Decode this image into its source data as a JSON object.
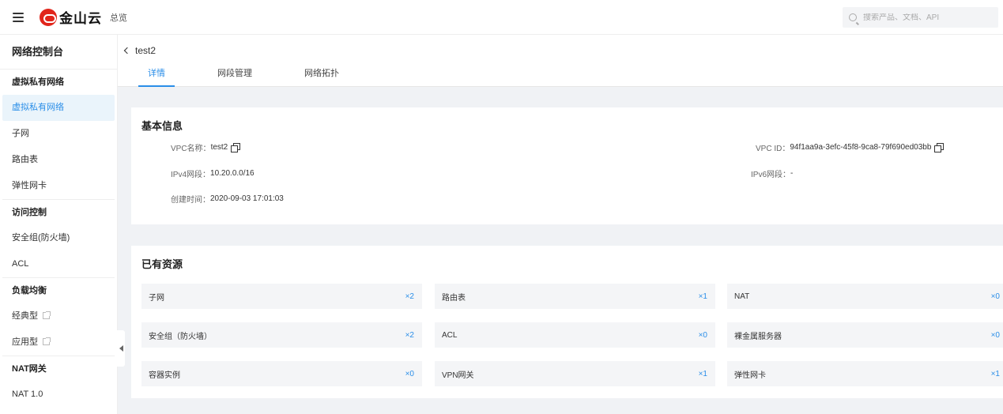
{
  "topbar": {
    "logo_text": "金山云",
    "overview": "总览",
    "search_placeholder": "搜索产品、文档、API"
  },
  "sidebar": {
    "title": "网络控制台",
    "groups": [
      {
        "label": "虚拟私有网络",
        "items": [
          "虚拟私有网络",
          "子网",
          "路由表",
          "弹性网卡"
        ]
      },
      {
        "label": "访问控制",
        "items": [
          "安全组(防火墙)",
          "ACL"
        ]
      },
      {
        "label": "负载均衡",
        "items": [
          "经典型",
          "应用型"
        ]
      },
      {
        "label": "NAT网关",
        "items": [
          "NAT 1.0"
        ]
      }
    ]
  },
  "header": {
    "back_label": "test2",
    "tabs": [
      "详情",
      "网段管理",
      "网络拓扑"
    ]
  },
  "basic_info": {
    "title": "基本信息",
    "vpc_name_label": "VPC名称：",
    "vpc_name": "test2",
    "ipv4_label": "IPv4网段：",
    "ipv4": "10.20.0.0/16",
    "created_label": "创建时间：",
    "created": "2020-09-03 17:01:03",
    "vpc_id_label": "VPC ID：",
    "vpc_id": "94f1aa9a-3efc-45f8-9ca8-79f690ed03bb",
    "ipv6_label": "IPv6网段：",
    "ipv6": "-"
  },
  "resources": {
    "title": "已有资源",
    "items": [
      {
        "name": "子网",
        "count": "×2"
      },
      {
        "name": "路由表",
        "count": "×1"
      },
      {
        "name": "NAT",
        "count": "×0"
      },
      {
        "name": "安全组（防火墙）",
        "count": "×2"
      },
      {
        "name": "ACL",
        "count": "×0"
      },
      {
        "name": "裸金属服务器",
        "count": "×0"
      },
      {
        "name": "容器实例",
        "count": "×0"
      },
      {
        "name": "VPN网关",
        "count": "×1"
      },
      {
        "name": "弹性网卡",
        "count": "×1"
      }
    ]
  },
  "colors": {
    "accent": "#2a8ee8",
    "brand": "#e1251b",
    "active_bg": "#eaf4fb"
  }
}
